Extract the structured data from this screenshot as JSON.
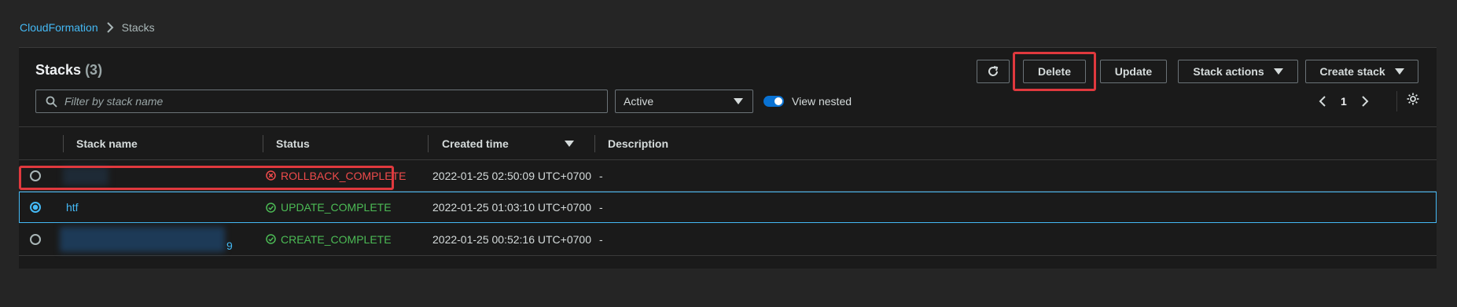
{
  "breadcrumb": {
    "parent": "CloudFormation",
    "current": "Stacks"
  },
  "header": {
    "title": "Stacks",
    "count": "(3)"
  },
  "toolbar": {
    "refresh_icon": "refresh-icon",
    "delete_label": "Delete",
    "update_label": "Update",
    "stack_actions_label": "Stack actions",
    "create_stack_label": "Create stack"
  },
  "filter": {
    "placeholder": "Filter by stack name",
    "status_value": "Active",
    "view_nested_label": "View nested",
    "view_nested_on": true
  },
  "pagination": {
    "current_page": "1"
  },
  "table": {
    "columns": [
      "Stack name",
      "Status",
      "Created time",
      "Description"
    ],
    "rows": [
      {
        "name": "",
        "status": "ROLLBACK_COMPLETE",
        "created": "2022-01-25 02:50:09 UTC+0700",
        "description": "-",
        "selected": false
      },
      {
        "name": "htf",
        "status": "UPDATE_COMPLETE",
        "created": "2022-01-25 01:03:10 UTC+0700",
        "description": "-",
        "selected": true
      },
      {
        "name": "9",
        "status": "CREATE_COMPLETE",
        "created": "2022-01-25 00:52:16 UTC+0700",
        "description": "-",
        "selected": false
      }
    ]
  },
  "colors": {
    "link": "#44b9f5",
    "error": "#ef4b4b",
    "success": "#4cbb55",
    "highlight": "#e0393e"
  }
}
